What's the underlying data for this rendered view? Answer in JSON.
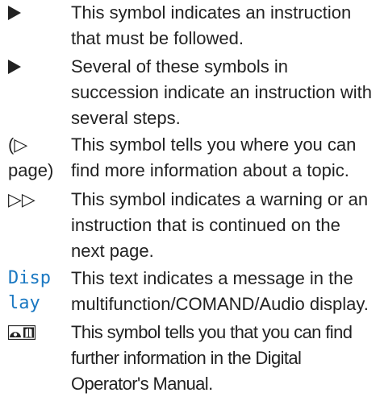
{
  "entries": [
    {
      "symbol_icon": "solid-triangle-right-icon",
      "description": "This symbol indicates an instruction that must be followed."
    },
    {
      "symbol_icon": "solid-triangle-right-icon",
      "description": "Several of these symbols in succession indicate an instruction with several steps."
    },
    {
      "symbol_text": "(▷ page)",
      "description": "This symbol tells you where you can find more information about a topic."
    },
    {
      "symbol_text": "▷▷",
      "description": "This symbol indicates a warning or an instruction that is continued on the next page."
    },
    {
      "symbol_text": "Display",
      "description": "This text indicates a message in the multifunction/COMAND/Audio display."
    },
    {
      "symbol_icon": "steering-wheel-book-icon",
      "description": "This symbol tells you that you can find further information in the Digital Operator's Manual."
    }
  ],
  "colors": {
    "text": "#222222",
    "display_label": "#1a78c2",
    "background": "#ffffff"
  }
}
